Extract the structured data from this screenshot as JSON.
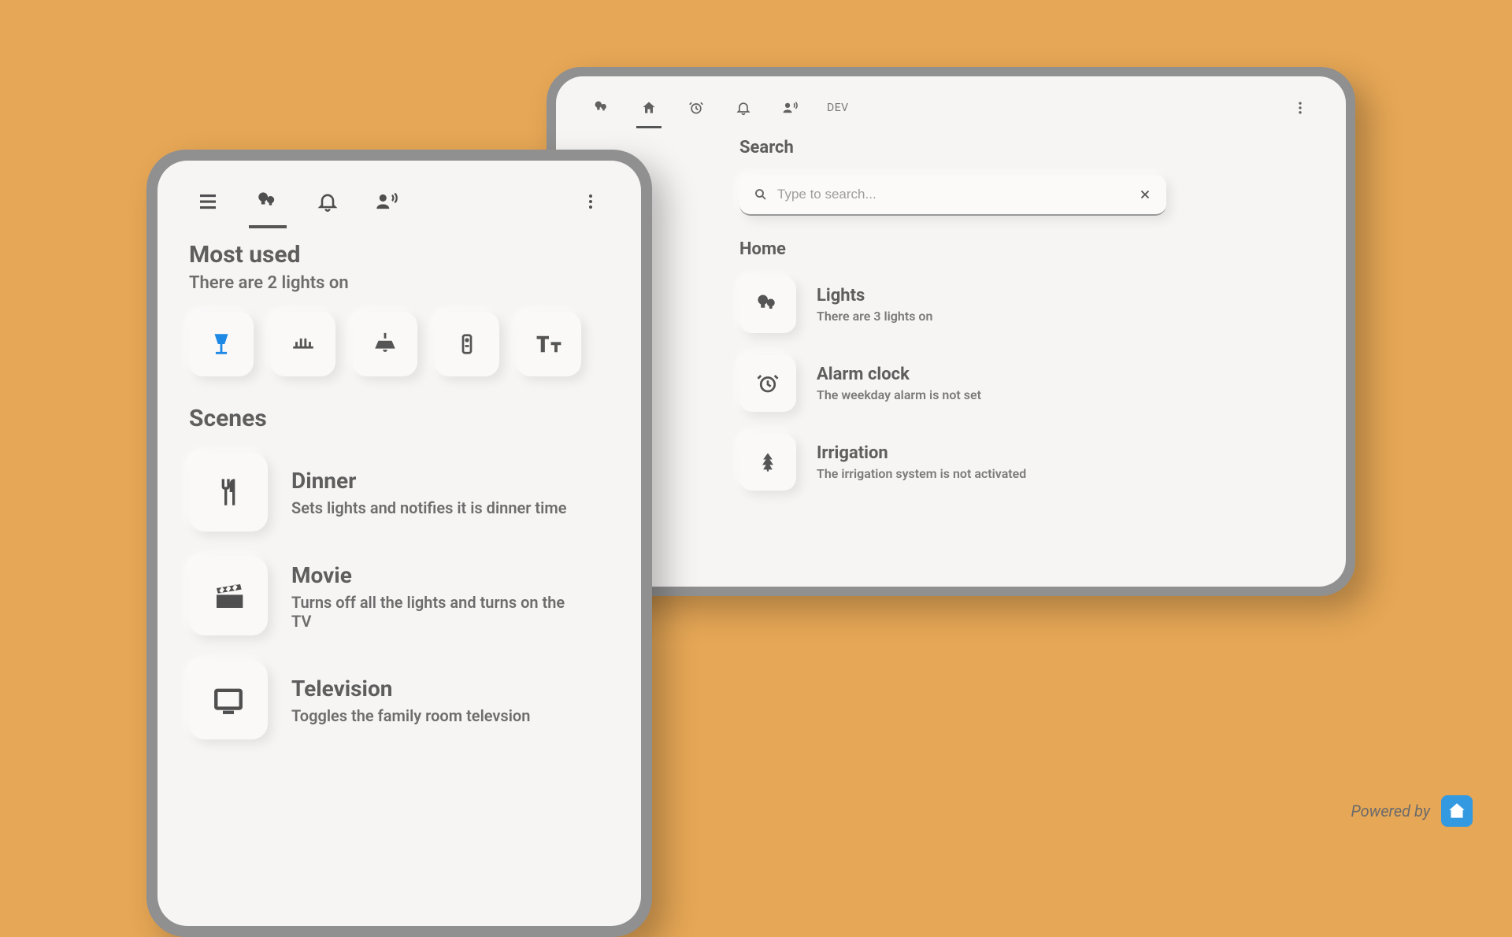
{
  "tablet": {
    "dev_label": "DEV",
    "search_heading": "Search",
    "search_placeholder": "Type to search...",
    "home_heading": "Home",
    "items": [
      {
        "title": "Lights",
        "subtitle": "There are 3 lights on"
      },
      {
        "title": "Alarm clock",
        "subtitle": "The weekday alarm is not set"
      },
      {
        "title": "Irrigation",
        "subtitle": "The irrigation system is not activated"
      }
    ]
  },
  "phone": {
    "most_used_title": "Most used",
    "most_used_subtitle": "There are 2 lights on",
    "scenes_title": "Scenes",
    "scenes": [
      {
        "title": "Dinner",
        "subtitle": "Sets lights and notifies it is dinner time"
      },
      {
        "title": "Movie",
        "subtitle": "Turns off all the lights and turns on the TV"
      },
      {
        "title": "Television",
        "subtitle": "Toggles the family room televsion"
      }
    ]
  },
  "footer": {
    "text": "Powered by"
  }
}
